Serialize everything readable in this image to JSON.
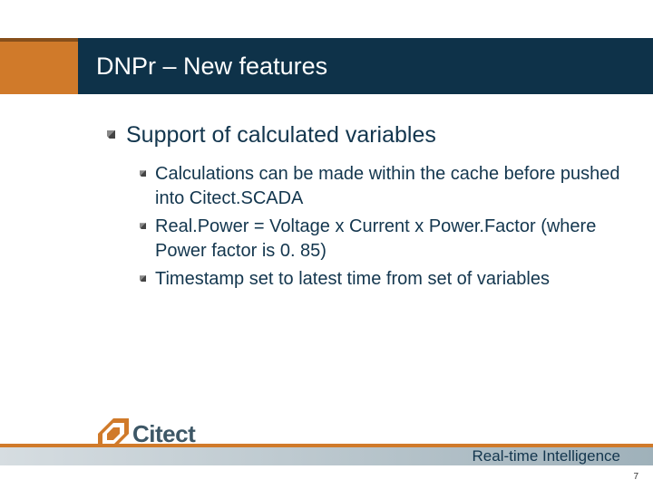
{
  "header": {
    "title": "DNPr – New features"
  },
  "content": {
    "heading": "Support of calculated variables",
    "bullets": [
      "Calculations can be made within the cache before pushed into Citect.SCADA",
      "Real.Power = Voltage x Current x Power.Factor (where Power factor is 0. 85)",
      "Timestamp set to latest time from set of variables"
    ]
  },
  "footer": {
    "logo_text": "Citect",
    "tagline": "Real-time Intelligence",
    "page_number": "7"
  }
}
